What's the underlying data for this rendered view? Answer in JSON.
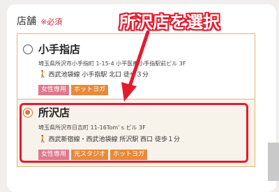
{
  "field": {
    "label": "店舗",
    "required": "※必須"
  },
  "stores": [
    {
      "name": "小手指店",
      "address": "埼玉県所沢市小手指町 1-15-4 小平医療小手指駅前ビル 3F",
      "access": "西武池袋線 小手指駅 北口 徒歩３分",
      "tags": [
        "女性専用",
        "ホットヨガ"
      ],
      "selected": false
    },
    {
      "name": "所沢店",
      "address": "埼玉県所沢市日吉町 11-16Tom' s ビル 3F",
      "access": "西武新宿線・西武池袋線 所沢駅 西口 徒歩１分",
      "tags": [
        "女性専用",
        "光スタジオ",
        "ホットヨガ"
      ],
      "selected": true
    }
  ],
  "annotation": {
    "text": "所沢店を選択",
    "color": "#e31b2e"
  },
  "icons": {
    "access": "walker-icon"
  }
}
